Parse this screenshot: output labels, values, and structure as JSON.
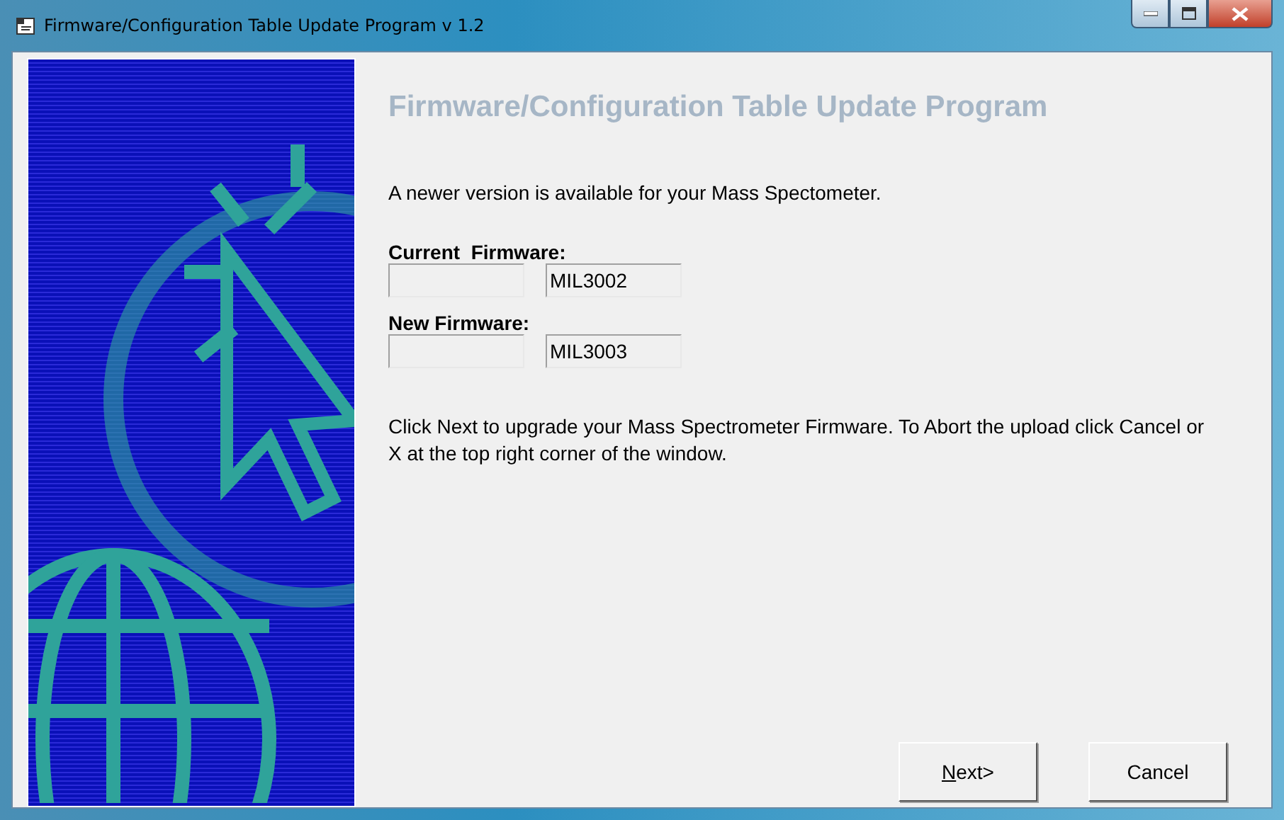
{
  "window": {
    "title": "Firmware/Configuration Table Update Program v 1.2"
  },
  "heading": "Firmware/Configuration Table Update Program",
  "intro": "A newer version is available for your Mass Spectometer.",
  "firmware_fields": [
    {
      "label": "Current  Firmware:",
      "value": "MIL3002"
    },
    {
      "label": "New Firmware:",
      "value": "MIL3003"
    }
  ],
  "instructions": "Click Next to upgrade your Mass Spectrometer Firmware. To Abort the upload click Cancel or X at the top right corner of the window.",
  "buttons": [
    {
      "label": "Next>",
      "mnemonic_underlined": true
    },
    {
      "label": "Cancel",
      "mnemonic_underlined": false
    }
  ]
}
